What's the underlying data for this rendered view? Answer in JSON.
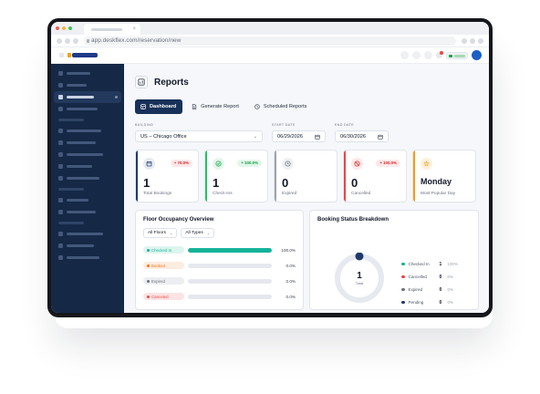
{
  "browser": {
    "url": "app.deskflex.com/reservation/new",
    "traffic_lights": [
      "#ef5b5b",
      "#f2b63d",
      "#3cc356"
    ]
  },
  "page": {
    "title": "Reports"
  },
  "tabs": [
    {
      "label": "Dashboard",
      "icon": "dashboard-icon",
      "active": true
    },
    {
      "label": "Generate Report",
      "icon": "document-icon",
      "active": false
    },
    {
      "label": "Scheduled Reports",
      "icon": "clock-icon",
      "active": false
    }
  ],
  "filters": {
    "building": {
      "label": "BUILDING",
      "value": "US – Chicago Office"
    },
    "start_date": {
      "label": "START DATE",
      "value": "06/29/2026"
    },
    "end_date": {
      "label": "END DATE",
      "value": "06/30/2026"
    }
  },
  "stats": [
    {
      "id": "total-bookings",
      "value": "1",
      "label": "Total Bookings",
      "badge": "+ 70.0%",
      "badge_type": "red",
      "accent": "#1e3a6b",
      "icon": "calendar-icon"
    },
    {
      "id": "check-ins",
      "value": "1",
      "label": "Check-Ins",
      "badge": "+ 100.0%",
      "badge_type": "green",
      "accent": "#22c55e",
      "icon": "check-circle-icon"
    },
    {
      "id": "expired",
      "value": "0",
      "label": "Expired",
      "badge": "",
      "badge_type": "",
      "accent": "#9ca3af",
      "icon": "clock-icon"
    },
    {
      "id": "cancelled",
      "value": "0",
      "label": "Cancelled",
      "badge": "+ 100.0%",
      "badge_type": "red",
      "accent": "#ef4444",
      "icon": "ban-icon"
    },
    {
      "id": "most-popular-day",
      "value": "Monday",
      "label": "Most Popular Day",
      "badge": "",
      "badge_type": "",
      "accent": "#f59e0b",
      "icon": "star-icon"
    }
  ],
  "occupancy": {
    "title": "Floor Occupancy Overview",
    "floor_filter": "All Floors",
    "type_filter": "All Types",
    "rows": [
      {
        "status": "Checked In",
        "pct": "100.0%",
        "fraction": 1.0,
        "color": "#14b39a",
        "bg": "#dcf5ee"
      },
      {
        "status": "Booked",
        "pct": "0.0%",
        "fraction": 0.0,
        "color": "#f97316",
        "bg": "#fdece0"
      },
      {
        "status": "Expired",
        "pct": "0.0%",
        "fraction": 0.0,
        "color": "#6b7280",
        "bg": "#eceef1"
      },
      {
        "status": "Canceled",
        "pct": "0.0%",
        "fraction": 0.0,
        "color": "#ef4444",
        "bg": "#fde4e4"
      }
    ]
  },
  "breakdown": {
    "title": "Booking Status Breakdown",
    "total": "1",
    "total_label": "Total",
    "items": [
      {
        "name": "Checked In",
        "count": "1",
        "pct": "100%",
        "fraction": 1.0,
        "color": "#14b39a"
      },
      {
        "name": "Cancelled",
        "count": "0",
        "pct": "0%",
        "fraction": 0.0,
        "color": "#ef4444"
      },
      {
        "name": "Expired",
        "count": "0",
        "pct": "0%",
        "fraction": 0.0,
        "color": "#6b7280"
      },
      {
        "name": "Pending",
        "count": "0",
        "pct": "0%",
        "fraction": 0.0,
        "color": "#1e3a6b"
      }
    ]
  }
}
